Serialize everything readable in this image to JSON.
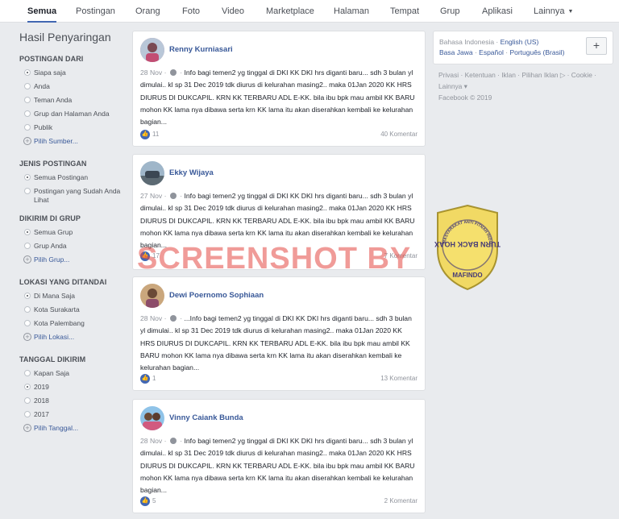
{
  "tabs": [
    "Semua",
    "Postingan",
    "Orang",
    "Foto",
    "Video",
    "Marketplace",
    "Halaman",
    "Tempat",
    "Grup",
    "Aplikasi",
    "Lainnya"
  ],
  "sidebar": {
    "title": "Hasil Penyaringan",
    "sections": [
      {
        "heading": "POSTINGAN DARI",
        "options": [
          "Siapa saja",
          "Anda",
          "Teman Anda",
          "Grup dan Halaman Anda",
          "Publik"
        ],
        "more": "Pilih Sumber..."
      },
      {
        "heading": "JENIS POSTINGAN",
        "options": [
          "Semua Postingan",
          "Postingan yang Sudah Anda Lihat"
        ]
      },
      {
        "heading": "DIKIRIM DI GRUP",
        "options": [
          "Semua Grup",
          "Grup Anda"
        ],
        "more": "Pilih Grup..."
      },
      {
        "heading": "LOKASI YANG DITANDAI",
        "options": [
          "Di Mana Saja",
          "Kota Surakarta",
          "Kota Palembang"
        ],
        "more": "Pilih Lokasi..."
      },
      {
        "heading": "TANGGAL DIKIRIM",
        "options": [
          "Kapan Saja",
          "2019",
          "2018",
          "2017"
        ],
        "more": "Pilih Tanggal..."
      }
    ]
  },
  "posts": [
    {
      "author": "Renny Kurniasari",
      "date": "28 Nov",
      "text": "Info bagi temen2 yg tinggal di DKI KK DKI hrs diganti baru... sdh 3 bulan yl dimulai.. kl sp 31 Dec 2019 tdk diurus di kelurahan masing2.. maka 01Jan 2020 KK HRS DIURUS DI DUKCAPIL. KRN KK TERBARU ADL E-KK. bila ibu bpk mau ambil KK BARU mohon KK lama nya dibawa serta krn KK lama itu akan diserahkan kembali ke kelurahan bagian...",
      "likes": "11",
      "comments": "40 Komentar"
    },
    {
      "author": "Ekky Wijaya",
      "date": "27 Nov",
      "text": "Info bagi temen2 yg tinggal di DKI KK DKI hrs diganti baru... sdh 3 bulan yl dimulai.. kl sp 31 Dec 2019 tdk diurus di kelurahan masing2.. maka 01Jan 2020 KK HRS DIURUS DI DUKCAPIL. KRN KK TERBARU ADL E-KK. bila ibu bpk mau ambil KK BARU mohon KK lama nya dibawa serta krn KK lama itu akan diserahkan kembali ke kelurahan bagian...",
      "likes": "17",
      "comments": "7 Komentar"
    },
    {
      "author": "Dewi Poernomo Sophiaan",
      "date": "28 Nov",
      "text": "...Info bagi temen2 yg tinggal di DKI KK DKI hrs diganti baru... sdh 3 bulan yl dimulai.. kl sp 31 Dec 2019 tdk diurus di kelurahan masing2.. maka 01Jan 2020 KK HRS DIURUS DI DUKCAPIL. KRN KK TERBARU ADL E-KK. bila ibu bpk mau ambil KK BARU mohon KK lama nya dibawa serta krn KK lama itu akan diserahkan kembali ke kelurahan bagian...",
      "likes": "1",
      "comments": "13 Komentar"
    },
    {
      "author": "Vinny Caiank Bunda",
      "date": "28 Nov",
      "text": "Info bagi temen2 yg tinggal di DKI KK DKI hrs diganti baru... sdh 3 bulan yl dimulai.. kl sp 31 Dec 2019 tdk diurus di kelurahan masing2.. maka 01Jan 2020 KK HRS DIURUS DI DUKCAPIL. KRN KK TERBARU ADL E-KK. bila ibu bpk mau ambil KK BARU mohon KK lama nya dibawa serta krn KK lama itu akan diserahkan kembali ke kelurahan bagian...",
      "likes": "5",
      "comments": "2 Komentar"
    }
  ],
  "languages": {
    "current": "Bahasa Indonesia",
    "links": [
      "English (US)",
      "Basa Jawa",
      "Español",
      "Português (Brasil)"
    ],
    "add_symbol": "+"
  },
  "footer": {
    "links": [
      "Privasi",
      "Ketentuan",
      "Iklan",
      "Pilihan Iklan",
      "Cookie",
      "Lainnya"
    ],
    "copyright": "Facebook © 2019"
  },
  "watermark": {
    "text": "SCREENSHOT BY",
    "logo_top": "TURN BACK HOAX",
    "logo_bottom": "MAFINDO",
    "logo_ring": "MASYARAKAT ANTI FITNAH INDONESIA"
  },
  "colors": {
    "accent": "#4267b2",
    "link": "#385898",
    "background": "#e9ebee",
    "watermark_red": "#e44844",
    "logo_yellow": "#f2d64b"
  }
}
